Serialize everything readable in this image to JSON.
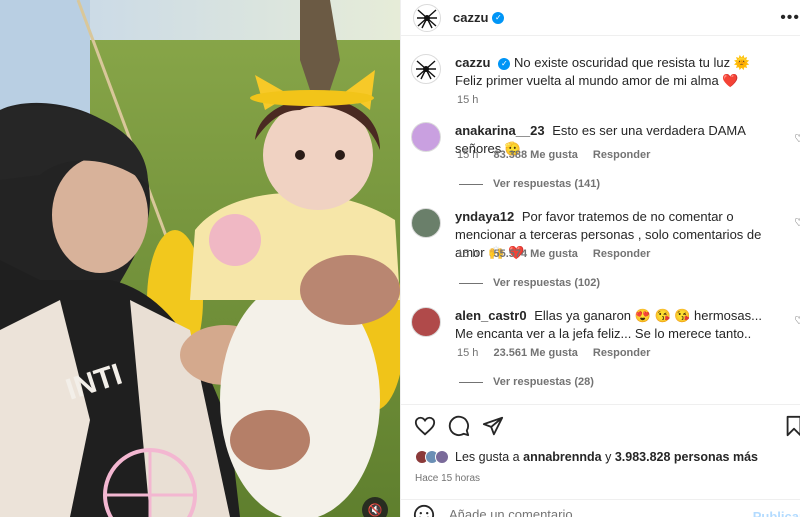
{
  "post": {
    "author": "cazzu",
    "more_icon": "more-horizontal-icon"
  },
  "caption": {
    "username": "cazzu",
    "line1": "No existe oscuridad que resista tu luz",
    "emoji1": "🌞",
    "line2": "Feliz primer vuelta al mundo amor de mi alma",
    "emoji2": "❤️",
    "time": "15 h"
  },
  "comments": [
    {
      "username": "anakarina__23",
      "text": "Esto es ser una verdadera DAMA señores 🫡",
      "time": "15 h",
      "likes": "83.388 Me gusta",
      "reply": "Responder",
      "view_replies": "Ver respuestas (141)"
    },
    {
      "username": "yndaya12",
      "text": "Por favor tratemos de no comentar o mencionar a terceras personas , solo comentarios de amor 🙌 ❤️",
      "time": "15 h",
      "likes": "55.574 Me gusta",
      "reply": "Responder",
      "view_replies": "Ver respuestas (102)"
    },
    {
      "username": "alen_castr0",
      "text": "Ellas ya ganaron 😍 😘 😘 hermosas... Me encanta ver a la jefa feliz... Se lo merece tanto..",
      "time": "15 h",
      "likes": "23.561 Me gusta",
      "reply": "Responder",
      "view_replies": "Ver respuestas (28)"
    }
  ],
  "actions": {
    "like_icon": "heart-icon",
    "comment_icon": "comment-icon",
    "share_icon": "send-icon",
    "save_icon": "bookmark-icon"
  },
  "likes": {
    "prefix": "Les gusta a",
    "user": "annabrennda",
    "middle": "y",
    "count": "3.983.828 personas más"
  },
  "posted_ago": "Hace 15 horas",
  "add_comment": {
    "placeholder": "Añade un comentario...",
    "post_label": "Publicar"
  },
  "media": {
    "mute_icon": "volume-muted-icon"
  },
  "colors": {
    "accent": "#0095f6",
    "secondary_text": "#737373",
    "heart_red": "#ed4956"
  }
}
